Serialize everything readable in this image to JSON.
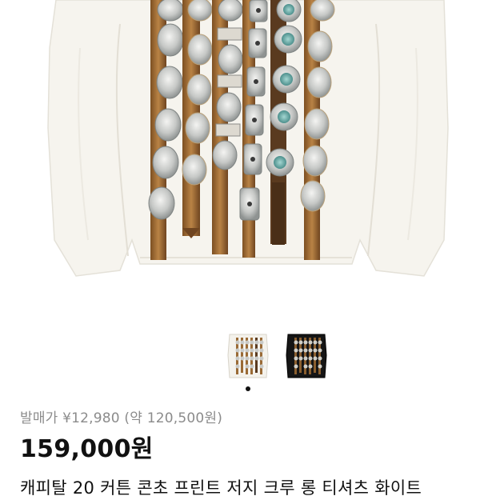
{
  "product": {
    "retail_price": "발매가 ¥12,980 (약 120,500원)",
    "price": "159,000원",
    "title": "캐피탈 20 커튼 콘초 프린트 저지 크루 롱 티셔츠 화이트"
  },
  "gallery": {
    "thumbnails": [
      {
        "label": "white-variant",
        "shirt_color": "#f4f2ec"
      },
      {
        "label": "black-variant",
        "shirt_color": "#151515"
      }
    ],
    "active_index": 0
  },
  "colors": {
    "shirt_white": "#f6f4ee",
    "leather_brown": "#a8733a",
    "concho_silver": "#c9cbc8",
    "turquoise": "#6fb0b0",
    "text_primary": "#111111",
    "text_secondary": "#8b8b8b"
  }
}
